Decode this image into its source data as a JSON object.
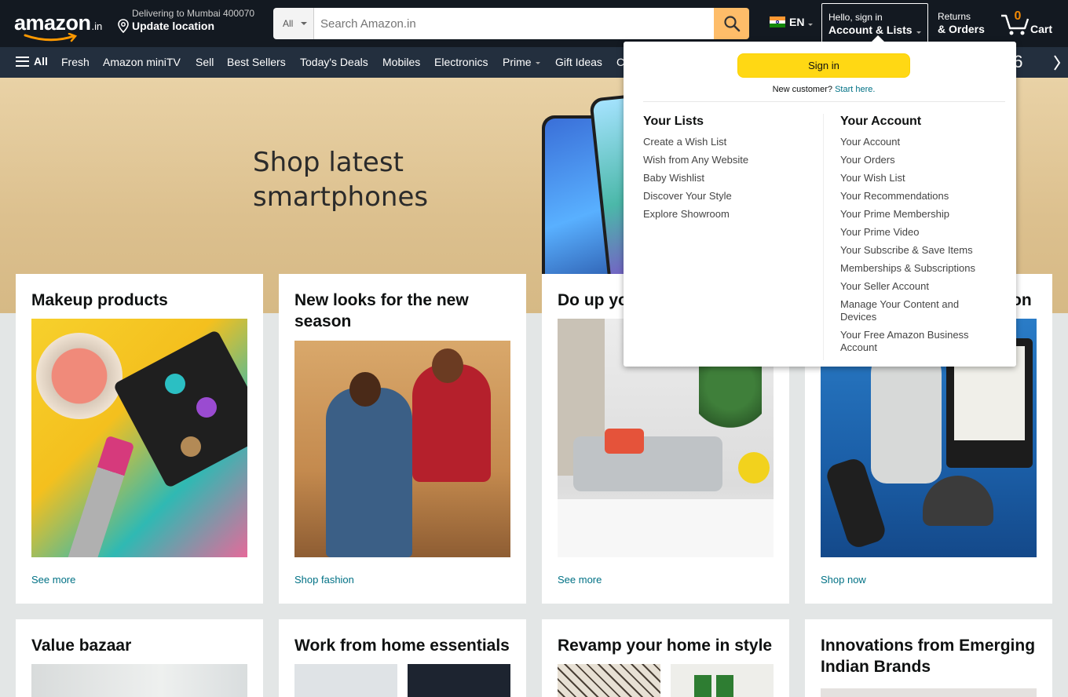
{
  "header": {
    "logo_text": "amazon",
    "logo_tld": ".in",
    "deliver_line1": "Delivering to Mumbai 400070",
    "deliver_line2": "Update location",
    "search_category": "All",
    "search_placeholder": "Search Amazon.in",
    "language": "EN",
    "account_line1": "Hello, sign in",
    "account_line2": "Account & Lists",
    "returns_line1": "Returns",
    "returns_line2": "& Orders",
    "cart_count": "0",
    "cart_label": "Cart"
  },
  "subnav": {
    "all_label": "All",
    "links": [
      "Fresh",
      "Amazon miniTV",
      "Sell",
      "Best Sellers",
      "Today's Deals",
      "Mobiles",
      "Electronics",
      "Prime",
      "Gift Ideas",
      "C"
    ],
    "promo_text": "06"
  },
  "hero": {
    "headline_line1": "Shop latest",
    "headline_line2": "smartphones"
  },
  "cards": [
    {
      "title": "Makeup products",
      "link": "See more"
    },
    {
      "title": "New looks for the new season",
      "link": "Shop fashion"
    },
    {
      "title": "Do up your",
      "link": "See more"
    },
    {
      "title": "on",
      "link": "Shop now"
    },
    {
      "title": "Value bazaar"
    },
    {
      "title": "Work from home essentials"
    },
    {
      "title": "Revamp your home in style"
    },
    {
      "title": "Innovations from Emerging Indian Brands"
    }
  ],
  "flyout": {
    "signin_label": "Sign in",
    "new_customer_text": "New customer?",
    "start_here": "Start here.",
    "lists_heading": "Your Lists",
    "lists": [
      "Create a Wish List",
      "Wish from Any Website",
      "Baby Wishlist",
      "Discover Your Style",
      "Explore Showroom"
    ],
    "account_heading": "Your Account",
    "account": [
      "Your Account",
      "Your Orders",
      "Your Wish List",
      "Your Recommendations",
      "Your Prime Membership",
      "Your Prime Video",
      "Your Subscribe & Save Items",
      "Memberships & Subscriptions",
      "Your Seller Account",
      "Manage Your Content and Devices",
      "Your Free Amazon Business Account"
    ]
  },
  "colors": {
    "nav_dark": "#131921",
    "nav_sub": "#232f3e",
    "search_button": "#febd69",
    "signin_button": "#ffd814",
    "link": "#007185",
    "cart_count": "#f08804"
  }
}
